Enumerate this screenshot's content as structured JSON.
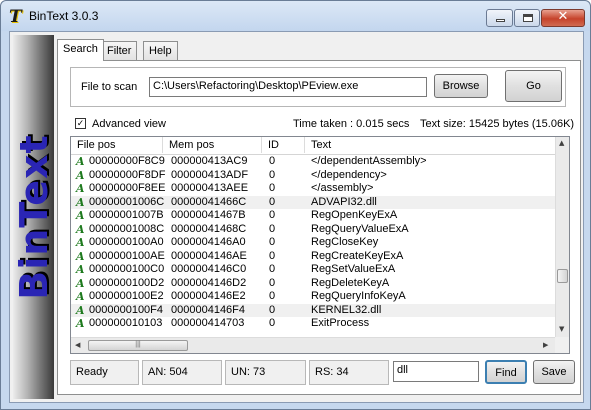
{
  "window": {
    "title": "BinText 3.0.3",
    "close_glyph": "✕"
  },
  "banner": {
    "text": "BinText"
  },
  "tabs": [
    {
      "label": "Search"
    },
    {
      "label": "Filter"
    },
    {
      "label": "Help"
    }
  ],
  "search": {
    "file_label": "File to scan",
    "file_value": "C:\\Users\\Refactoring\\Desktop\\PEview.exe",
    "browse_label": "Browse",
    "go_label": "Go",
    "advanced_label": "Advanced view",
    "advanced_checked": "✓",
    "time_taken": "Time taken : 0.015 secs",
    "text_size": "Text size: 15425 bytes (15.06K)"
  },
  "list": {
    "columns": [
      "File pos",
      "Mem pos",
      "ID",
      "Text"
    ],
    "row_marker": "A",
    "rows": [
      {
        "file": "00000000F8C9",
        "mem": "000000413AC9",
        "id": "0",
        "text": "</dependentAssembly>"
      },
      {
        "file": "00000000F8DF",
        "mem": "000000413ADF",
        "id": "0",
        "text": "</dependency>"
      },
      {
        "file": "00000000F8EE",
        "mem": "000000413AEE",
        "id": "0",
        "text": "</assembly>"
      },
      {
        "file": "00000001006C",
        "mem": "00000041466C",
        "id": "0",
        "text": "ADVAPI32.dll"
      },
      {
        "file": "00000001007B",
        "mem": "00000041467B",
        "id": "0",
        "text": "RegOpenKeyExA"
      },
      {
        "file": "00000001008C",
        "mem": "00000041468C",
        "id": "0",
        "text": "RegQueryValueExA"
      },
      {
        "file": "0000000100A0",
        "mem": "0000004146A0",
        "id": "0",
        "text": "RegCloseKey"
      },
      {
        "file": "0000000100AE",
        "mem": "0000004146AE",
        "id": "0",
        "text": "RegCreateKeyExA"
      },
      {
        "file": "0000000100C0",
        "mem": "0000004146C0",
        "id": "0",
        "text": "RegSetValueExA"
      },
      {
        "file": "0000000100D2",
        "mem": "0000004146D2",
        "id": "0",
        "text": "RegDeleteKeyA"
      },
      {
        "file": "0000000100E2",
        "mem": "0000004146E2",
        "id": "0",
        "text": "RegQueryInfoKeyA"
      },
      {
        "file": "0000000100F4",
        "mem": "0000004146F4",
        "id": "0",
        "text": "KERNEL32.dll"
      },
      {
        "file": "000000010103",
        "mem": "000000414703",
        "id": "0",
        "text": "ExitProcess"
      }
    ],
    "scroll_up": "▲",
    "scroll_down": "▼",
    "scroll_left": "◀",
    "scroll_right": "▶",
    "hthumb_grip": "|||"
  },
  "status": {
    "state": "Ready",
    "an": "AN: 504",
    "un": "UN: 73",
    "rs": "RS: 34",
    "find_value": "dll",
    "find_label": "Find",
    "save_label": "Save"
  }
}
